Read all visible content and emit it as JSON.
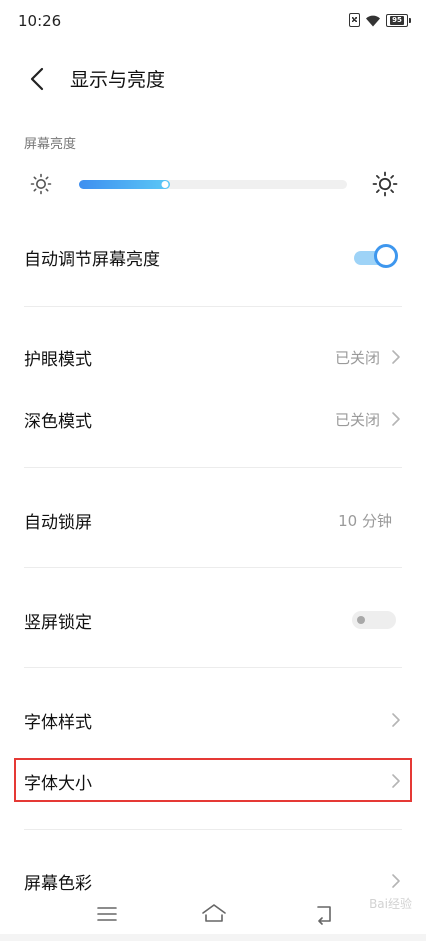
{
  "status_bar": {
    "time": "10:26",
    "battery": "95"
  },
  "header": {
    "title": "显示与亮度",
    "back_icon": "chevron-left-icon"
  },
  "brightness": {
    "section_label": "屏幕亮度",
    "level_fraction": 0.34,
    "accent_colors": [
      "#3e8ff0",
      "#5bc8f6"
    ]
  },
  "settings": {
    "auto_brightness": {
      "label": "自动调节屏幕亮度",
      "enabled": true
    },
    "eye_care": {
      "label": "护眼模式",
      "value": "已关闭"
    },
    "dark_mode": {
      "label": "深色模式",
      "value": "已关闭"
    },
    "auto_lock": {
      "label": "自动锁屏",
      "value": "10 分钟"
    },
    "portrait_lock": {
      "label": "竖屏锁定",
      "enabled": false
    },
    "font_style": {
      "label": "字体样式"
    },
    "font_size": {
      "label": "字体大小",
      "highlighted": true,
      "highlight_color": "#e53935"
    },
    "screen_color": {
      "label": "屏幕色彩"
    }
  },
  "nav_bar": {
    "icons": [
      "menu-icon",
      "home-icon",
      "back-icon"
    ],
    "watermark": "Bai经验"
  },
  "colors": {
    "toggle_on": "#3e97ee",
    "toggle_on_track": "#9ed3f7",
    "secondary_text": "#9a9a9a"
  }
}
